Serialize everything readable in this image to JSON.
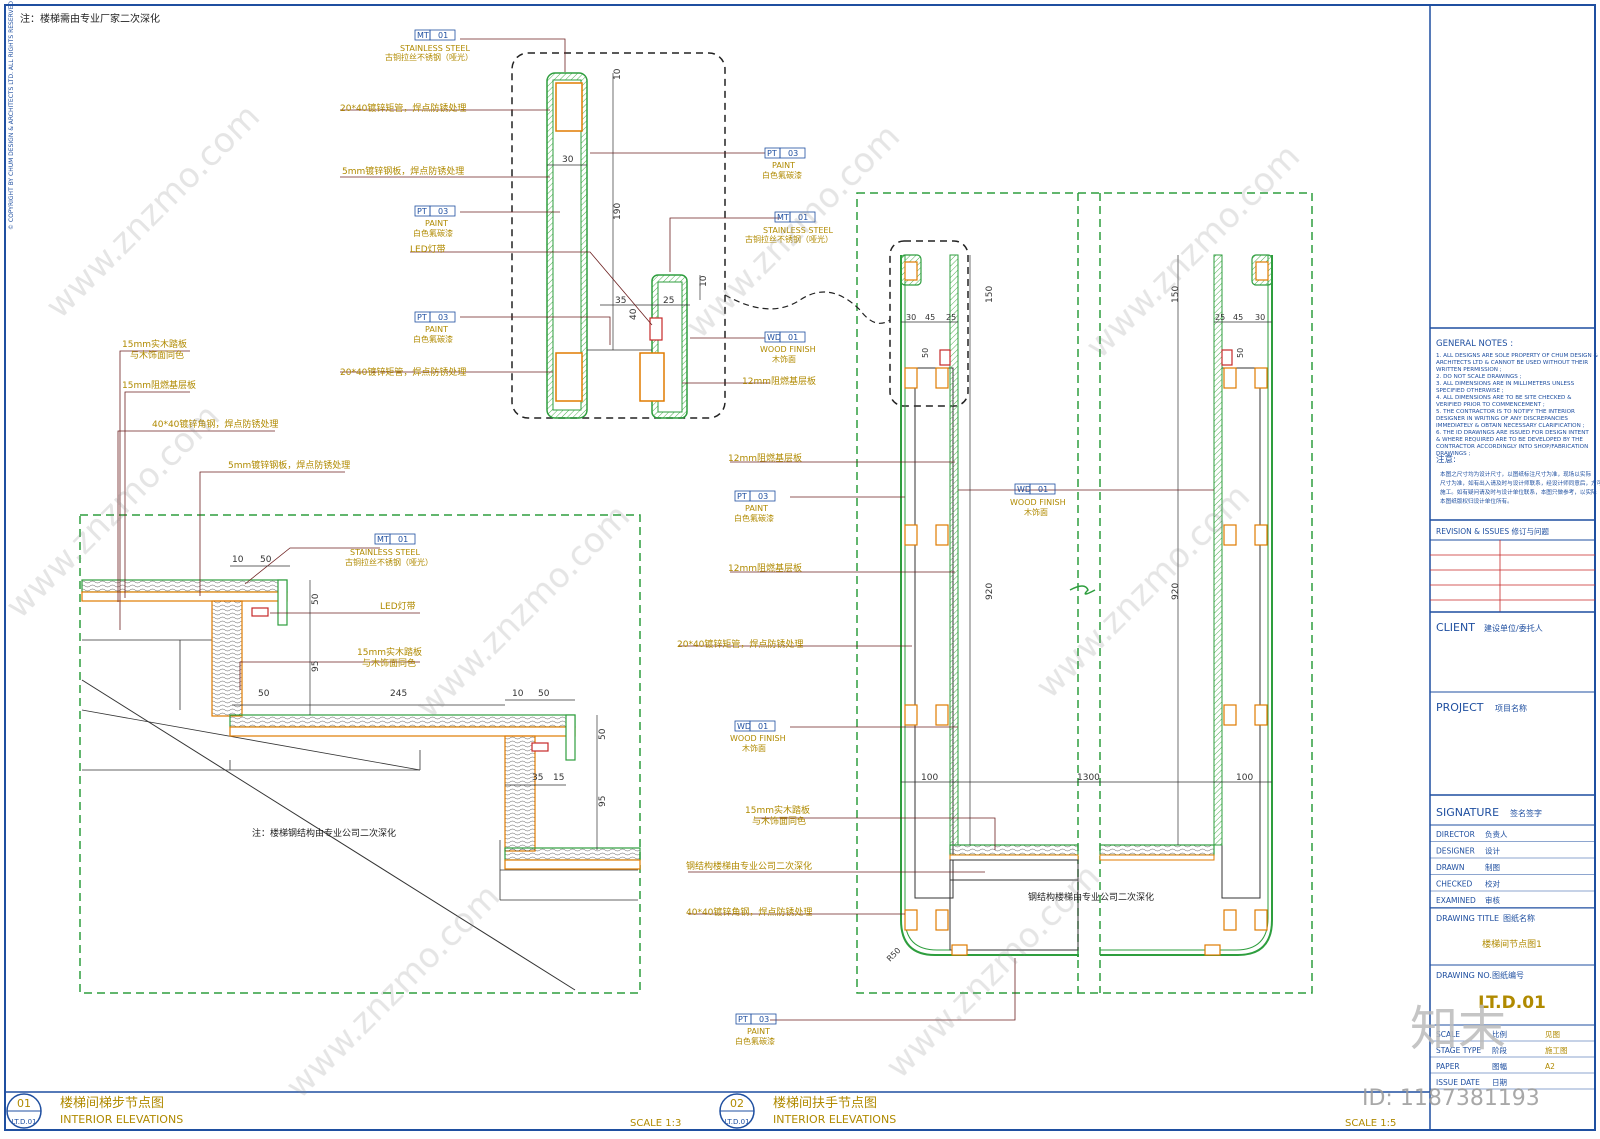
{
  "sheet": {
    "top_note": "注：楼梯需由专业厂家二次深化",
    "copyright_vertical": "© COPYRIGHT BY CHUM DESIGN & ARCHITECTS LTD. ALL RIGHTS RESERVED",
    "watermark_text": "www.znzmo.com",
    "watermark_cn": "知末网",
    "logo_text": "知末",
    "id_text": "ID: 1187381193"
  },
  "detail1": {
    "number": "01",
    "ref": "LT.D.01",
    "title_cn": "楼梯间梯步节点图",
    "title_en": "INTERIOR  ELEVATIONS",
    "scale": "SCALE  1:3",
    "note": "注：楼梯钢结构由专业公司二次深化",
    "tag_mt_code": "MT",
    "tag_mt_num": "01",
    "tag_mt_en": "STAINLESS  STEEL",
    "tag_mt_cn": "古铜拉丝不锈钢（哑光）",
    "l_tread1": "15mm实木踏板",
    "l_tread1b": "与木饰面同色",
    "l_base": "15mm阻燃基层板",
    "l_angle": "40*40镀锌角钢，焊点防锈处理",
    "l_plate": "5mm镀锌钢板，焊点防锈处理",
    "l_led": "LED灯带",
    "l_tread2": "15mm实木踏板",
    "l_tread2b": "与木饰面同色",
    "d10a": "10",
    "d50a": "50",
    "d50b": "50",
    "d95a": "95",
    "d50c": "50",
    "d245": "245",
    "d10b": "10",
    "d50d": "50",
    "d50e": "50",
    "d35": "35",
    "d15": "15",
    "d95b": "95"
  },
  "detail2": {
    "number": "02",
    "ref": "LT.D.01",
    "title_cn": "楼梯间扶手节点图",
    "title_en": "INTERIOR  ELEVATIONS",
    "scale": "SCALE  1:5",
    "mt_code": "MT",
    "mt_num": "01",
    "mt_en": "STAINLESS  STEEL",
    "mt_cn": "古铜拉丝不锈钢（哑光）",
    "pt_code": "PT",
    "pt_num": "03",
    "pt_en": "PAINT",
    "pt_cn": "白色氟碳漆",
    "wd_code": "WD",
    "wd_num": "01",
    "wd_en": "WOOD  FINISH",
    "wd_cn": "木饰面",
    "l_tube": "20*40镀锌矩管，焊点防锈处理",
    "l_plate": "5mm镀锌钢板，焊点防锈处理",
    "l_led": "LED灯带",
    "l_base12": "12mm阻燃基层板",
    "l_tread": "15mm实木踏板",
    "l_treadb": "与木饰面同色",
    "l_steel": "钢结构楼梯由专业公司二次深化",
    "l_angle": "40*40镀锌角钢，焊点防锈处理",
    "center_note": "钢结构楼梯由专业公司二次深化",
    "d10": "10",
    "d30": "30",
    "d190": "190",
    "d35": "35",
    "d40": "40",
    "d25": "25",
    "d10b": "10",
    "d150": "150",
    "d45": "45",
    "d50": "50",
    "d920": "920",
    "d100": "100",
    "d1300": "1300",
    "r50": "R50"
  },
  "titleblock": {
    "notes_title": "GENERAL NOTES :",
    "notes": [
      "1. ALL DESIGNS ARE SOLE PROPERTY OF CHUM DESIGN &",
      "   ARCHITECTS LTD & CANNOT BE USED WITHOUT THEIR",
      "   WRITTEN PERMISSION ;",
      "2. DO NOT SCALE DRAWINGS ;",
      "3. ALL DIMENSIONS ARE IN MILLIMETERS UNLESS",
      "   SPECIFIED OTHERWISE ;",
      "4. ALL DIMENSIONS ARE TO BE SITE CHECKED &",
      "   VERIFIED  PRIOR TO COMMENCEMENT ;",
      "5. THE CONTRACTOR IS TO NOTIFY THE INTERIOR",
      "   DESIGNER IN WRITING OF ANY DISCREPANCIES",
      "   IMMEDIATELY & OBTAIN NECESSARY CLARIFICATION ;",
      "6. THE ID DRAWINGS ARE ISSUED FOR DESIGN INTENT",
      "   & WHERE REQUIRED ARE TO BE DEVELOPED BY THE",
      "   CONTRACTOR ACCORDINGLY INTO SHOP/FABRICATION",
      "   DRAWINGS ;"
    ],
    "cn_notes_title": "注意:",
    "cn_notes": [
      "本图之尺寸均为设计尺寸，以图纸标注尺寸为准，现场以实际",
      "尺寸为准，如有出入请及时与设计师联系，经设计师同意后，方可",
      "施工。如有疑问请及时与设计单位联系，本图只做参考，以实际",
      "本图纸版权归设计单位所有。"
    ],
    "revision": "REVISION & ISSUES  修订与问题",
    "client": "CLIENT",
    "client_cn": "建设单位/委托人",
    "project": "PROJECT",
    "project_cn": "项目名称",
    "signature": "SIGNATURE",
    "signature_cn": "签名签字",
    "rows": [
      {
        "en": "DIRECTOR",
        "cn": "负责人"
      },
      {
        "en": "DESIGNER",
        "cn": "设计"
      },
      {
        "en": "DRAWN",
        "cn": "制图"
      },
      {
        "en": "CHECKED",
        "cn": "校对"
      },
      {
        "en": "EXAMINED",
        "cn": "审核"
      }
    ],
    "drawing_title": "DRAWING TITLE",
    "drawing_title_cn": "图纸名称",
    "drawing_title_value": "楼梯间节点图1",
    "drawing_no": "DRAWING NO.",
    "drawing_no_cn": "图纸编号",
    "drawing_no_value": "LT.D.01",
    "bottom_rows": [
      {
        "en": "SCALE",
        "cn": "比例",
        "val": "见图"
      },
      {
        "en": "STAGE TYPE",
        "cn": "阶段",
        "val": "施工图"
      },
      {
        "en": "PAPER",
        "cn": "图幅",
        "val": "A2"
      },
      {
        "en": "ISSUE DATE",
        "cn": "日期",
        "val": ""
      }
    ]
  }
}
